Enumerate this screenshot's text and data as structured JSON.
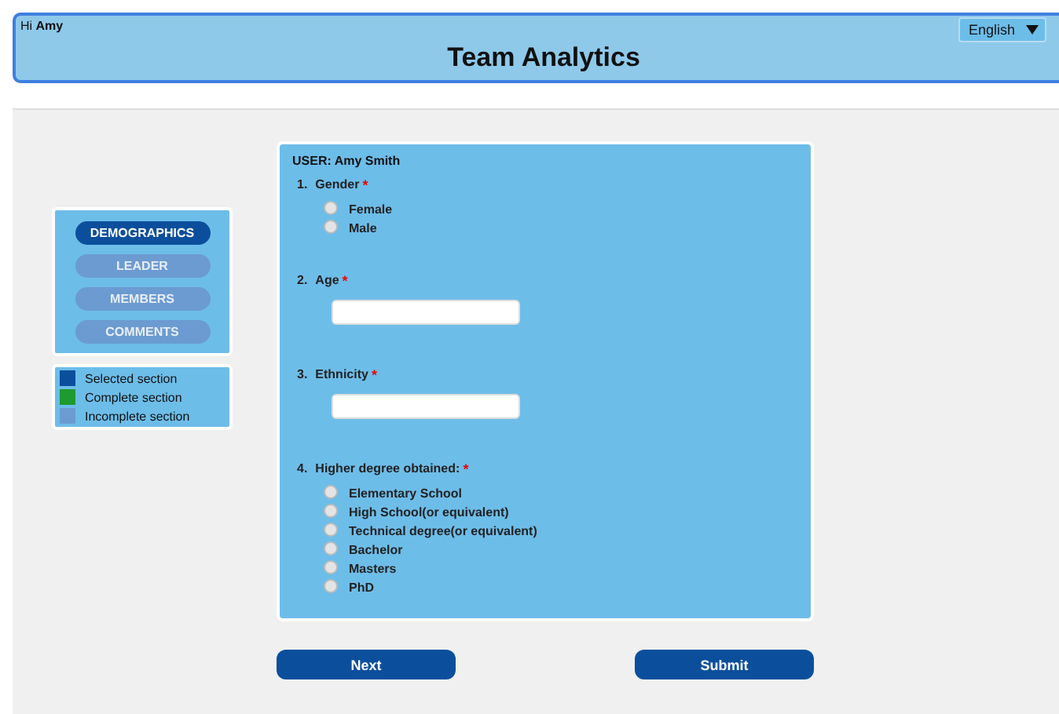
{
  "header": {
    "greeting_prefix": "Hi",
    "user_name": "Amy",
    "title": "Team Analytics",
    "language": "English"
  },
  "sections": [
    {
      "label": "DEMOGRAPHICS",
      "selected": true
    },
    {
      "label": "LEADER",
      "selected": false
    },
    {
      "label": "MEMBERS",
      "selected": false
    },
    {
      "label": "COMMENTS",
      "selected": false
    }
  ],
  "legend": [
    {
      "label": "Selected section",
      "color": "#0b4f9c"
    },
    {
      "label": "Complete section",
      "color": "#1e9a2e"
    },
    {
      "label": "Incomplete section",
      "color": "#6b9bd1"
    }
  ],
  "form": {
    "user": "USER: Amy Smith",
    "questions": [
      {
        "number": "1.",
        "label": "Gender",
        "required_mark": "*",
        "kind": "radio",
        "options": [
          {
            "label": "Female",
            "selected": false
          },
          {
            "label": "Male",
            "selected": false
          }
        ]
      },
      {
        "number": "2.",
        "label": "Age",
        "required_mark": "*",
        "kind": "text"
      },
      {
        "number": "3.",
        "label": "Ethnicity",
        "required_mark": "*",
        "kind": "text"
      },
      {
        "number": "4.",
        "label": "Higher degree obtained:",
        "required_mark": "*",
        "kind": "radio",
        "options": [
          {
            "label": "Elementary School",
            "selected": false
          },
          {
            "label": "High School(or equivalent)",
            "selected": false
          },
          {
            "label": "Technical degree(or equivalent)",
            "selected": false
          },
          {
            "label": "Bachelor",
            "selected": false
          },
          {
            "label": "Masters",
            "selected": false
          },
          {
            "label": "PhD",
            "selected": false
          }
        ]
      }
    ]
  },
  "buttons": [
    "Next",
    "Submit"
  ]
}
